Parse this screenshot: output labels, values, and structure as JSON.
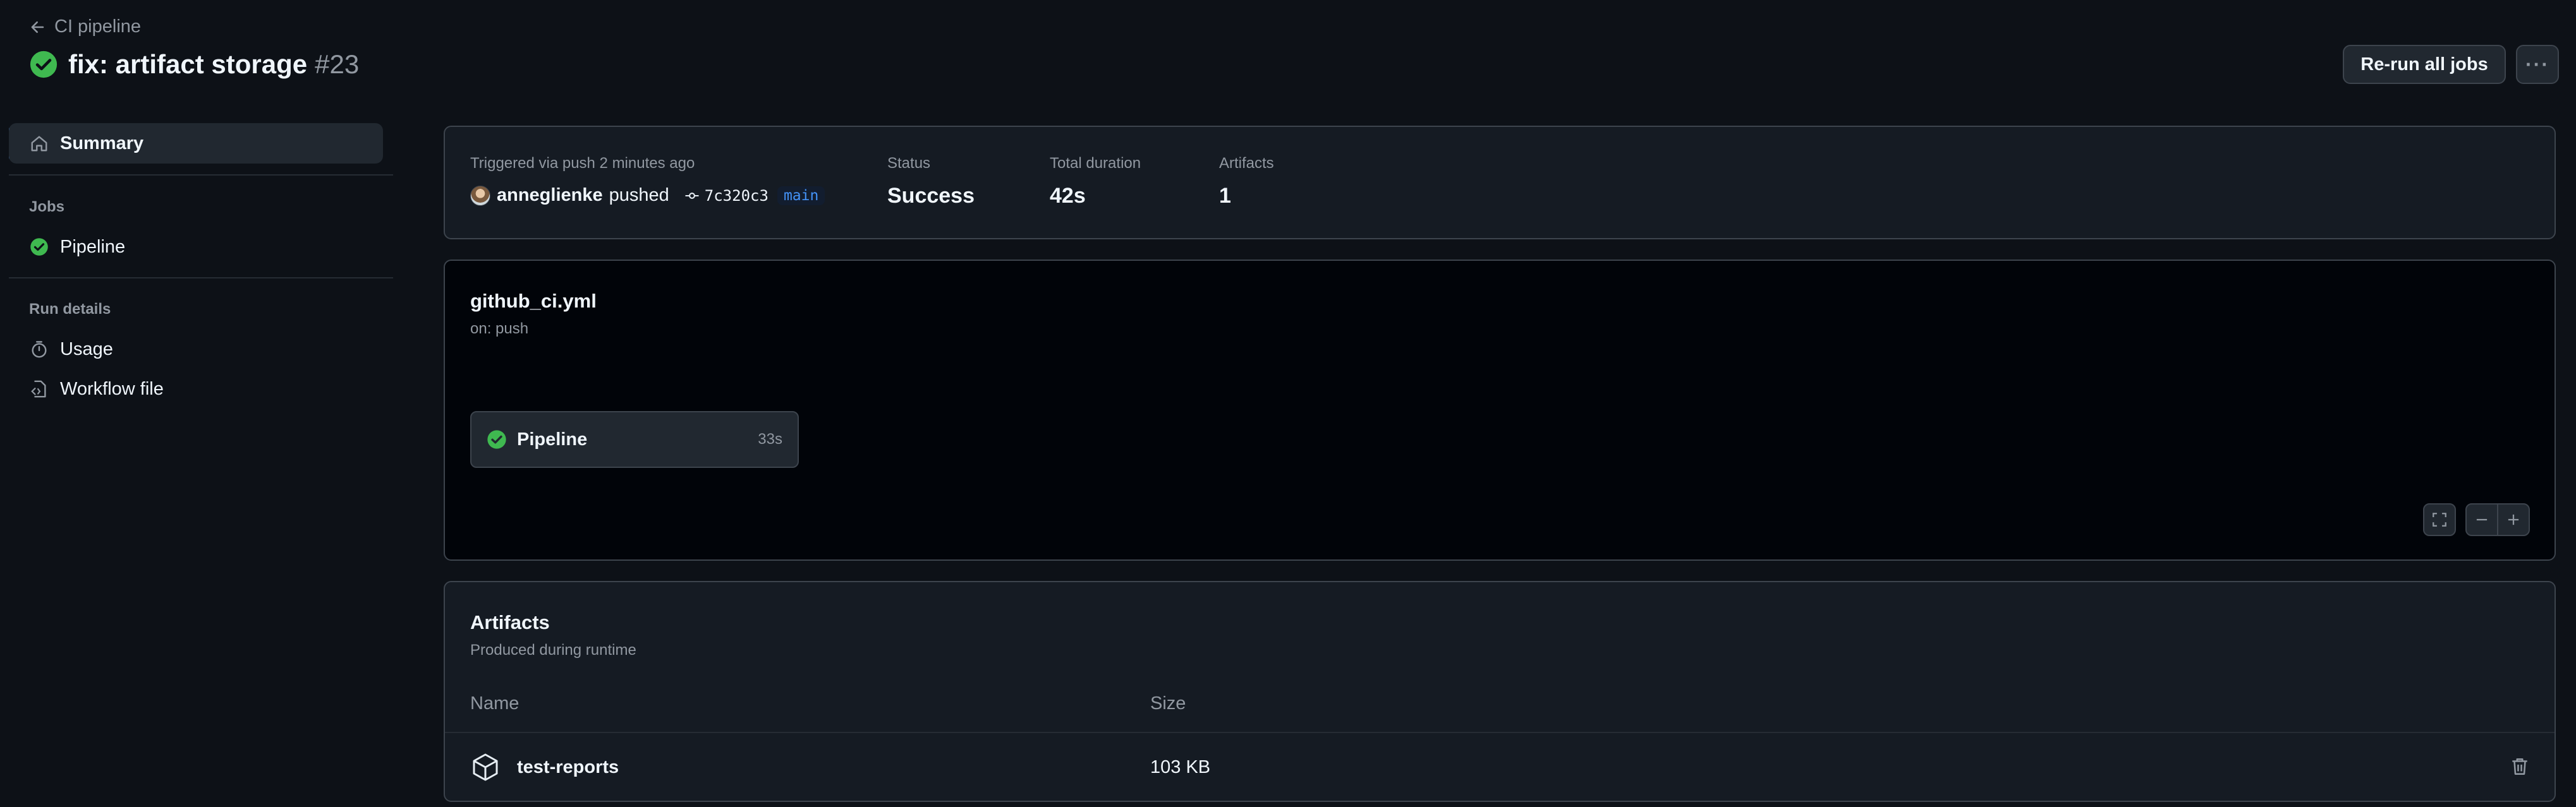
{
  "header": {
    "back_label": "CI pipeline",
    "title": "fix: artifact storage",
    "run_number": "#23",
    "rerun_label": "Re-run all jobs",
    "more_label": "···"
  },
  "sidebar": {
    "summary_label": "Summary",
    "jobs_heading": "Jobs",
    "job_item": "Pipeline",
    "run_details_heading": "Run details",
    "usage_label": "Usage",
    "workflow_file_label": "Workflow file"
  },
  "summary": {
    "trigger_text": "Triggered via push 2 minutes ago",
    "author": "anneglienke",
    "action": "pushed",
    "commit": "7c320c3",
    "branch": "main",
    "status_label": "Status",
    "status_value": "Success",
    "duration_label": "Total duration",
    "duration_value": "42s",
    "artifacts_label": "Artifacts",
    "artifacts_value": "1"
  },
  "workflow": {
    "file": "github_ci.yml",
    "trigger": "on: push",
    "job_name": "Pipeline",
    "job_duration": "33s"
  },
  "artifacts": {
    "title": "Artifacts",
    "subtitle": "Produced during runtime",
    "col_name": "Name",
    "col_size": "Size",
    "rows": [
      {
        "name": "test-reports",
        "size": "103 KB"
      }
    ]
  },
  "colors": {
    "success": "#3fb950",
    "accent": "#4493f8",
    "background": "#0d1117"
  }
}
